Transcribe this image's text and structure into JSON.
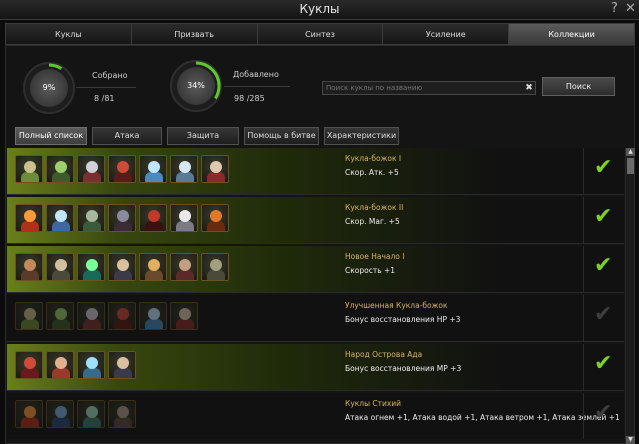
{
  "window": {
    "title": "Куклы",
    "help_icon": "?",
    "close_icon": "✕"
  },
  "tabs": [
    {
      "label": "Куклы",
      "active": false
    },
    {
      "label": "Призвать",
      "active": false
    },
    {
      "label": "Синтез",
      "active": false
    },
    {
      "label": "Усиление",
      "active": false
    },
    {
      "label": "Коллекции",
      "active": true
    }
  ],
  "stats": {
    "collected": {
      "percent_label": "9%",
      "percent": 0.09,
      "label": "Собрано",
      "current": "8",
      "total": "/81"
    },
    "added": {
      "percent_label": "34%",
      "percent": 0.34,
      "label": "Добавлено",
      "current": "98",
      "total": "/285"
    }
  },
  "search": {
    "placeholder": "Поиск куклы по названию",
    "clear_icon": "✖",
    "button_label": "Поиск"
  },
  "filters": [
    {
      "label": "Полный список",
      "active": true
    },
    {
      "label": "Атака",
      "active": false
    },
    {
      "label": "Защита",
      "active": false
    },
    {
      "label": "Помощь в битве",
      "active": false
    },
    {
      "label": "Характеристики",
      "active": false
    }
  ],
  "collections": [
    {
      "name": "Кукла-божок I",
      "bonus": "Скор. Атк. +5",
      "completed": true,
      "dolls": [
        "dust-sack-doll",
        "green-goblin-doll",
        "silver-knight-doll",
        "red-demon-doll",
        "ice-crystal-doll",
        "ice-golem-doll",
        "red-cleric-doll"
      ]
    },
    {
      "name": "Кукла-божок II",
      "bonus": "Скор. Маг. +5",
      "completed": true,
      "dolls": [
        "flame-spirit-doll",
        "ice-beast-doll",
        "armored-warrior-doll",
        "dark-knight-doll",
        "horned-devil-doll",
        "white-mage-doll",
        "fire-demon-doll"
      ]
    },
    {
      "name": "Новое Начало I",
      "bonus": "Скорость +1",
      "completed": true,
      "dolls": [
        "maned-beast-doll",
        "elder-sage-doll",
        "green-orb-doll",
        "bandit-doll",
        "lion-warrior-doll",
        "orc-chief-doll",
        "stone-golem-doll"
      ]
    },
    {
      "name": "Улучшенная Кукла-божок",
      "bonus": "Бонус восстановления HP +3",
      "completed": false,
      "dolls": [
        "dust-sack-doll",
        "green-goblin-doll",
        "silver-knight-doll",
        "red-demon-doll",
        "ice-crystal-doll",
        "red-cleric-doll"
      ]
    },
    {
      "name": "Народ Острова Ада",
      "bonus": "Бонус восстановления MP +3",
      "completed": true,
      "dolls": [
        "red-imp-doll",
        "fire-witch-doll",
        "ice-troll-doll",
        "bandit-doll"
      ]
    },
    {
      "name": "Куклы Стихий",
      "bonus": "Атака огнем +1, Атака водой +1, Атака ветром +1, Атака землей +1",
      "completed": false,
      "dolls": [
        "flame-spirit-doll",
        "water-spirit-doll",
        "wind-spirit-doll",
        "earth-spirit-doll"
      ]
    }
  ],
  "doll_colors": {
    "dust-sack-doll": [
      "#c9c08a",
      "#6b8c3a"
    ],
    "green-goblin-doll": [
      "#9bd06b",
      "#3d5b2a"
    ],
    "silver-knight-doll": [
      "#d0d0d8",
      "#7a3030"
    ],
    "red-demon-doll": [
      "#d04a3a",
      "#5a1c14"
    ],
    "ice-crystal-doll": [
      "#bfe6ff",
      "#4a8ac0"
    ],
    "ice-golem-doll": [
      "#d8e8f0",
      "#5a7a9a"
    ],
    "red-cleric-doll": [
      "#e0c8b0",
      "#8a2a2a"
    ],
    "flame-spirit-doll": [
      "#ff9a3a",
      "#b0301a"
    ],
    "ice-beast-doll": [
      "#c0e6ff",
      "#3a6aa0"
    ],
    "armored-warrior-doll": [
      "#a8b8a0",
      "#3a5a3a"
    ],
    "dark-knight-doll": [
      "#8a8a9a",
      "#3a2a3a"
    ],
    "horned-devil-doll": [
      "#c03a2a",
      "#3a1010"
    ],
    "white-mage-doll": [
      "#e8e8e8",
      "#7a7a8a"
    ],
    "fire-demon-doll": [
      "#e07a2a",
      "#6a2a10"
    ],
    "maned-beast-doll": [
      "#c08a5a",
      "#5a3a2a"
    ],
    "elder-sage-doll": [
      "#d0c0a0",
      "#4a4a3a"
    ],
    "green-orb-doll": [
      "#7aff9a",
      "#1a6a5a"
    ],
    "bandit-doll": [
      "#d8c0a0",
      "#3a3a4a"
    ],
    "lion-warrior-doll": [
      "#e0b060",
      "#6a4a2a"
    ],
    "orc-chief-doll": [
      "#c0a080",
      "#5a2a2a"
    ],
    "stone-golem-doll": [
      "#a0a080",
      "#4a4a3a"
    ],
    "red-imp-doll": [
      "#d04a3a",
      "#6a1a1a"
    ],
    "fire-witch-doll": [
      "#e0b090",
      "#9a3a2a"
    ],
    "ice-troll-doll": [
      "#a0e0ff",
      "#3a6a8a"
    ],
    "water-spirit-doll": [
      "#7ab0e0",
      "#2a4a7a"
    ],
    "wind-spirit-doll": [
      "#a0e0c0",
      "#3a7a6a"
    ],
    "earth-spirit-doll": [
      "#b0a090",
      "#5a4a3a"
    ]
  },
  "scrollbar": {
    "up_icon": "▲",
    "down_icon": "▼"
  }
}
